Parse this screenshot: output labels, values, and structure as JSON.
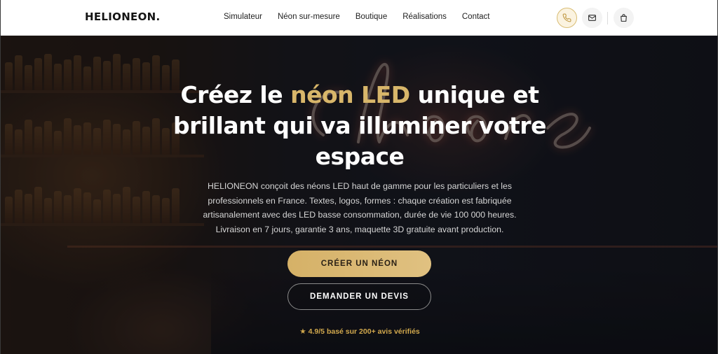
{
  "brand": {
    "logo": "HELIONEON."
  },
  "nav": {
    "items": [
      {
        "label": "Simulateur"
      },
      {
        "label": "Néon sur-mesure"
      },
      {
        "label": "Boutique"
      },
      {
        "label": "Réalisations"
      },
      {
        "label": "Contact"
      }
    ]
  },
  "header_icons": {
    "phone": "phone-icon",
    "mail": "mail-icon",
    "bag": "shopping-bag-icon"
  },
  "hero": {
    "title_part1": "Créez le ",
    "title_highlight": "néon LED",
    "title_part2": " unique et brillant qui va illuminer votre espace",
    "lead": "HELIONEON conçoit des néons LED haut de gamme pour les particuliers et les professionnels en France. Textes, logos, formes : chaque création est fabriquée artisanalement avec des LED basse consommation, durée de vie 100 000 heures. Livraison en 7 jours, garantie 3 ans, maquette 3D gratuite avant production.",
    "cta_primary": "CRÉER UN NÉON",
    "cta_secondary": "DEMANDER UN DEVIS",
    "rating_star": "★",
    "rating_text": "4.9/5 basé sur 200+ avis vérifiés"
  },
  "colors": {
    "gold": "#d8b66a",
    "rating": "#d2a94d",
    "header_bg": "#ffffff"
  }
}
